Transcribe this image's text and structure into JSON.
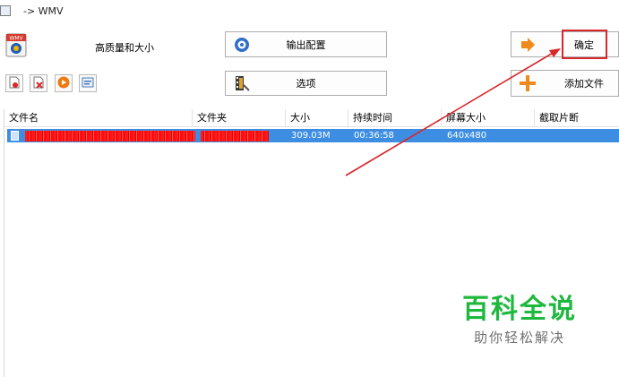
{
  "window": {
    "title": "-> WMV"
  },
  "profile": {
    "label": "高质量和大小",
    "icon": "wmv-icon"
  },
  "buttons": {
    "output_config": "输出配置",
    "options": "选项",
    "confirm": "确定",
    "add_file": "添加文件"
  },
  "toolbar_icons": [
    "remove-file-icon",
    "clear-list-icon",
    "play-icon",
    "media-info-icon"
  ],
  "table": {
    "columns": [
      "文件名",
      "文件夹",
      "大小",
      "持续时间",
      "屏幕大小",
      "截取片断"
    ],
    "rows": [
      {
        "filename": "",
        "folder": "",
        "size": "309.03M",
        "duration": "00:36:58",
        "screen_size": "640x480",
        "clip": ""
      }
    ]
  },
  "watermark": {
    "title": "百科全说",
    "subtitle": "助你轻松解决"
  },
  "colors": {
    "selection": "#3d8ee2",
    "highlight_box": "#d9262a",
    "arrow": "#d9262a",
    "watermark": "#1fb83e"
  }
}
